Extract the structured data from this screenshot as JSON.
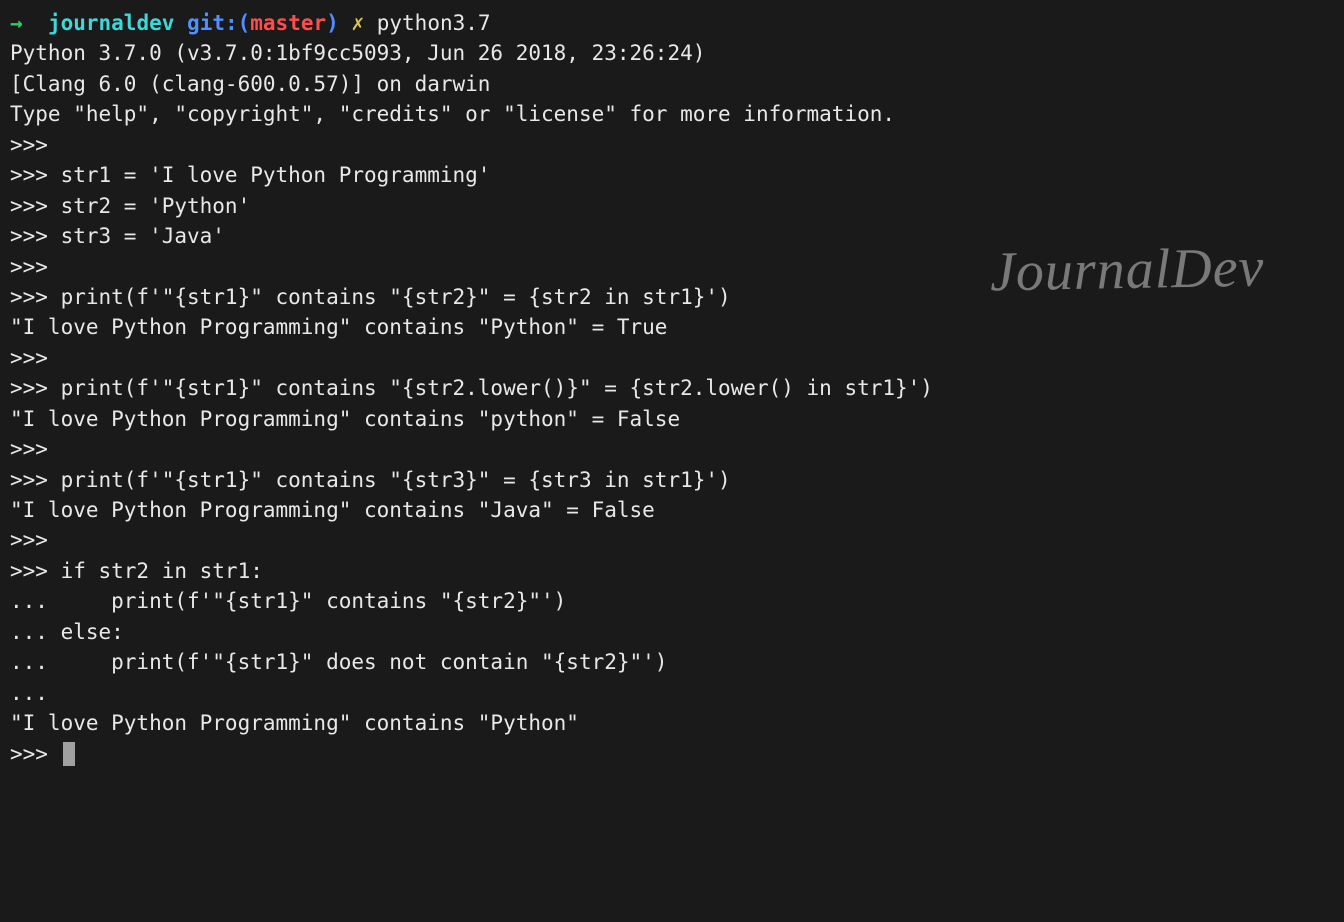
{
  "prompt": {
    "arrow": "→",
    "dir": "journaldev",
    "git_prefix": "git:(",
    "branch": "master",
    "close": ")",
    "x": "✗",
    "command": "python3.7"
  },
  "lines": {
    "l1": "Python 3.7.0 (v3.7.0:1bf9cc5093, Jun 26 2018, 23:26:24)",
    "l2": "[Clang 6.0 (clang-600.0.57)] on darwin",
    "l3": "Type \"help\", \"copyright\", \"credits\" or \"license\" for more information.",
    "l4": ">>> ",
    "l5": ">>> str1 = 'I love Python Programming'",
    "l6": ">>> str2 = 'Python'",
    "l7": ">>> str3 = 'Java'",
    "l8": ">>> ",
    "l9": ">>> print(f'\"{str1}\" contains \"{str2}\" = {str2 in str1}')",
    "l10": "\"I love Python Programming\" contains \"Python\" = True",
    "l11": ">>> ",
    "l12": ">>> print(f'\"{str1}\" contains \"{str2.lower()}\" = {str2.lower() in str1}')",
    "l13": "\"I love Python Programming\" contains \"python\" = False",
    "l14": ">>> ",
    "l15": ">>> print(f'\"{str1}\" contains \"{str3}\" = {str3 in str1}')",
    "l16": "\"I love Python Programming\" contains \"Java\" = False",
    "l17": ">>> ",
    "l18": ">>> if str2 in str1:",
    "l19": "...     print(f'\"{str1}\" contains \"{str2}\"')",
    "l20": "... else:",
    "l21": "...     print(f'\"{str1}\" does not contain \"{str2}\"')",
    "l22": "... ",
    "l23": "\"I love Python Programming\" contains \"Python\"",
    "l24": ">>> "
  },
  "watermark": "JournalDev"
}
